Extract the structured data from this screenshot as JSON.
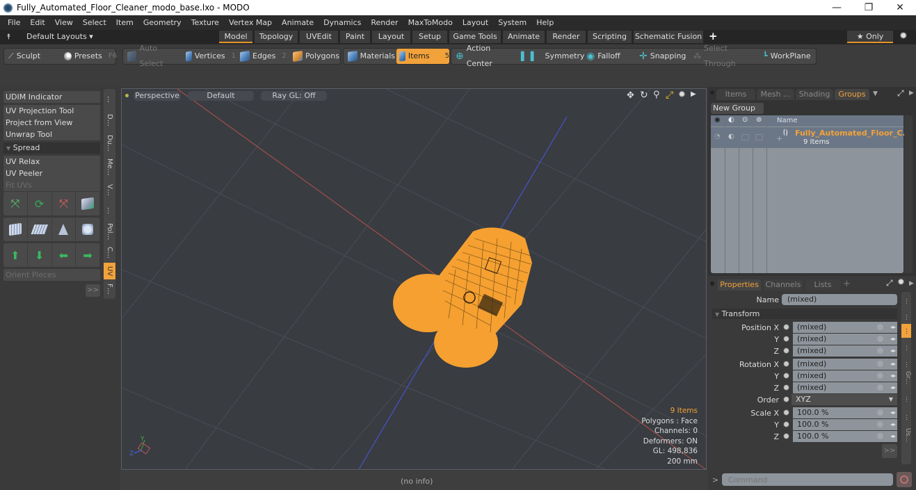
{
  "window": {
    "title": "Fully_Automated_Floor_Cleaner_modo_base.lxo - MODO",
    "controls": {
      "minimize": "—",
      "maximize": "❐",
      "close": "✕"
    }
  },
  "menu": [
    "File",
    "Edit",
    "View",
    "Select",
    "Item",
    "Geometry",
    "Texture",
    "Vertex Map",
    "Animate",
    "Dynamics",
    "Render",
    "MaxToModo",
    "Layout",
    "System",
    "Help"
  ],
  "layout_bar": {
    "layouts_label": "Default Layouts ▾",
    "tabs": [
      "Model",
      "Topology",
      "UVEdit",
      "Paint",
      "Layout",
      "Setup",
      "Game Tools",
      "Animate",
      "Render",
      "Scripting",
      "Schematic Fusion"
    ],
    "active_tab": "Model",
    "add": "+",
    "only_label": "★ Only"
  },
  "toolbar": {
    "sculpt": "Sculpt",
    "presets": "Presets",
    "presets_key": "F6",
    "auto_select": "Auto Select",
    "vertices": "Vertices",
    "vertices_key": "1",
    "edges": "Edges",
    "edges_key": "2",
    "polygons": "Polygons",
    "materials": "Materials",
    "items": "Items",
    "items_key": "5",
    "action_center": "Action Center",
    "symmetry": "Symmetry",
    "falloff": "Falloff",
    "snapping": "Snapping",
    "select_through": "Select Through",
    "workplane": "WorkPlane"
  },
  "left_panel": {
    "udim": "UDIM Indicator",
    "tools": [
      "UV Projection Tool",
      "Project from View",
      "Unwrap Tool"
    ],
    "spread_section": "Spread",
    "tools2": [
      "UV Relax",
      "UV Peeler",
      "Fit UVs"
    ],
    "orient": "Orient Pieces",
    "more": ">>",
    "vtabs": [
      "…",
      "D…",
      "Du…",
      "Me…",
      "V…",
      "…",
      "Pol…",
      "C…",
      "UV",
      "F…"
    ],
    "active_vtab": "UV"
  },
  "viewport": {
    "view": "Perspective",
    "style": "Default",
    "raygl": "Ray GL: Off",
    "info": {
      "items": "9 Items",
      "polygons": "Polygons : Face",
      "channels": "Channels: 0",
      "deformers": "Deformers: ON",
      "gl": "GL: 498,836",
      "scale": "200 mm"
    },
    "axis": {
      "y": "Y",
      "z": "Z"
    }
  },
  "status": "(no info)",
  "groups_panel": {
    "tabs": [
      "Items",
      "Mesh ...",
      "Shading",
      "Groups"
    ],
    "active_tab": "Groups",
    "new_group": "New Group",
    "name_header": "Name",
    "group_name": "Fully_Automated_Floor_C...",
    "group_count": "9 Items"
  },
  "properties_panel": {
    "tabs": [
      "Properties",
      "Channels",
      "Lists"
    ],
    "active_tab": "Properties",
    "name_label": "Name",
    "name_value": "(mixed)",
    "section": "Transform",
    "rows": [
      {
        "label": "Position X",
        "value": "(mixed)"
      },
      {
        "label": "Y",
        "value": "(mixed)"
      },
      {
        "label": "Z",
        "value": "(mixed)"
      },
      {
        "label": "Rotation X",
        "value": "(mixed)"
      },
      {
        "label": "Y",
        "value": "(mixed)"
      },
      {
        "label": "Z",
        "value": "(mixed)"
      },
      {
        "label": "Order",
        "value": "XYZ"
      },
      {
        "label": "Scale X",
        "value": "100.0 %"
      },
      {
        "label": "Y",
        "value": "100.0 %"
      },
      {
        "label": "Z",
        "value": "100.0 %"
      }
    ],
    "more": ">>",
    "side_tabs": [
      "…",
      "…",
      "…",
      "…",
      "…",
      "Gr…",
      "…",
      "…",
      "Us…"
    ]
  },
  "command": {
    "prompt": ">",
    "placeholder": "Command"
  },
  "colors": {
    "accent": "#f2a23a",
    "mesh": "#f5a030",
    "x_axis": "#c0504a",
    "z_axis": "#4455cc"
  }
}
